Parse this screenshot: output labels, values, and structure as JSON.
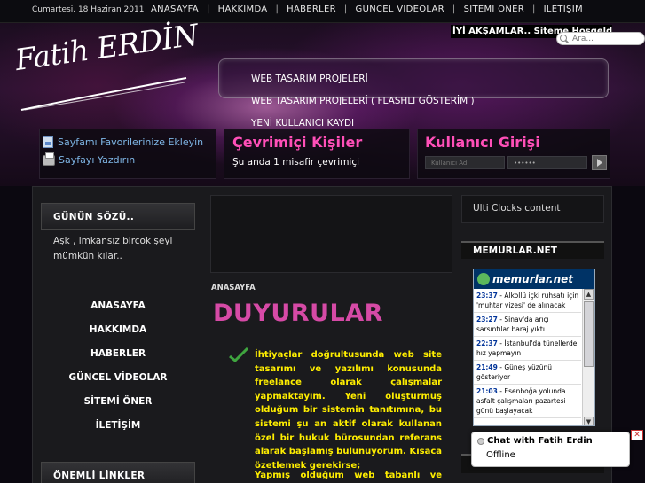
{
  "header": {
    "date": "Cumartesi. 18 Haziran 2011",
    "nav": [
      "ANASAYFA",
      "HAKKIMDA",
      "HABERLER",
      "GÜNCEL VİDEOLAR",
      "SİTEMİ ÖNER",
      "İLETİŞİM"
    ],
    "marquee": "İYİ AKŞAMLAR.. Siteme Hoşgeldin",
    "search_placeholder": "Ara...",
    "logo": "Fatih ERDİN"
  },
  "menu": [
    "WEB TASARIM PROJELERİ",
    "WEB TASARIM PROJELERİ ( FLASHLI GÖSTERİM )",
    "YENİ KULLANICI KAYDI"
  ],
  "favorites": {
    "add": "Sayfamı Favorilerinize Ekleyin",
    "print": "Sayfayı Yazdırın"
  },
  "online": {
    "title": "Çevrimiçi Kişiler",
    "text": "Şu anda 1 misafir çevrimiçi"
  },
  "login": {
    "title": "Kullanıcı Girişi",
    "username_placeholder": "Kullanıcı Adı",
    "password_value": "••••••"
  },
  "sidebar": {
    "quote_title": "GÜNÜN SÖZÜ..",
    "quote": "Aşk , imkansız birçok şeyi mümkün kılar..",
    "nav": [
      "ANASAYFA",
      "HAKKIMDA",
      "HABERLER",
      "GÜNCEL VİDEOLAR",
      "SİTEMİ ÖNER",
      "İLETİŞİM"
    ],
    "links_title": "ÖNEMLİ LİNKLER"
  },
  "main": {
    "breadcrumb": "ANASAYFA",
    "title": "DUYURULAR",
    "body": "İhtiyaçlar doğrultusunda web site tasarımı ve yazılımı konusunda freelance olarak çalışmalar yapmaktayım. Yeni oluşturmuş olduğum bir sistemin tanıtımına, bu sistemi şu an aktif olarak kullanan özel bir hukuk bürosundan referans alarak başlamış bulunuyorum. Kısaca özetlemek gerekirse;",
    "body2": "Yapmış olduğum web tabanlı ve"
  },
  "right": {
    "clocks": "Ulti Clocks content",
    "memurlar_title": "MEMURLAR.NET",
    "widget_logo": "memurlar.net",
    "news": [
      {
        "time": "23:37",
        "text": "Alkollü içki ruhsatı için 'muhtar vizesi' de alınacak"
      },
      {
        "time": "23:27",
        "text": "Sinav'da arıçı sarsıntılar baraj yıktı"
      },
      {
        "time": "22:37",
        "text": "İstanbul'da tünellerde hız yapmayın"
      },
      {
        "time": "21:49",
        "text": "Güneş yüzünü gösteriyor"
      },
      {
        "time": "21:03",
        "text": "Esenboğa yolunda asfalt çalışmaları pazartesi günü başlayacak"
      }
    ]
  },
  "chat": {
    "title": "Chat with Fatih Erdin",
    "status": "Offline"
  },
  "colors": {
    "accent_pink": "#ff4fb8",
    "text_yellow": "#ffee00",
    "link_blue": "#7fb6e6"
  }
}
